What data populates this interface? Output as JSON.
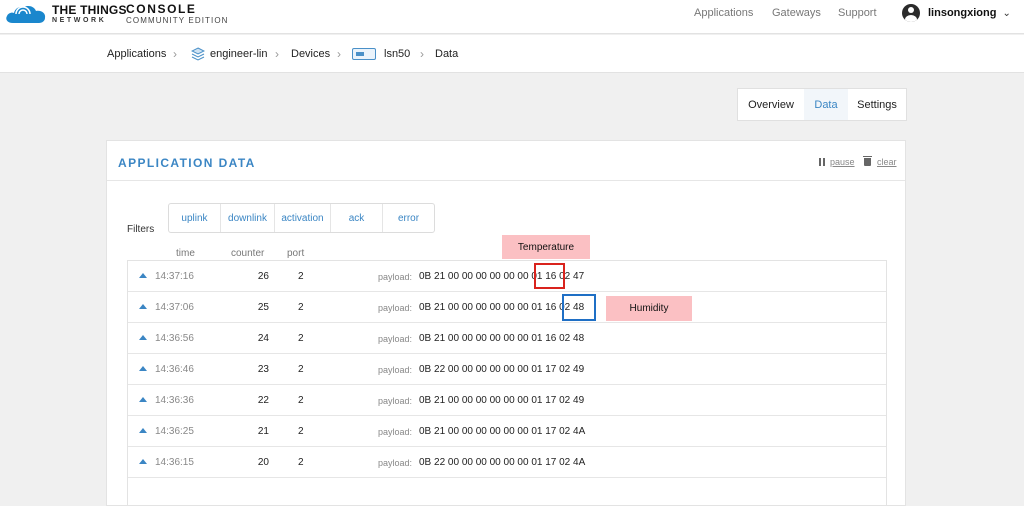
{
  "header": {
    "brand_line1": "THE THINGS",
    "brand_line2": "NETWORK",
    "console_title": "CONSOLE",
    "console_edition": "COMMUNITY EDITION",
    "nav": [
      "Applications",
      "Gateways",
      "Support"
    ],
    "username": "linsongxiong"
  },
  "breadcrumb": {
    "items": [
      "Applications",
      "engineer-lin",
      "Devices",
      "lsn50",
      "Data"
    ]
  },
  "tabs": [
    {
      "label": "Overview",
      "active": false
    },
    {
      "label": "Data",
      "active": true
    },
    {
      "label": "Settings",
      "active": false
    }
  ],
  "card": {
    "title": "APPLICATION DATA",
    "pause_label": "pause",
    "clear_label": "clear",
    "filters_label": "Filters",
    "filters": [
      "uplink",
      "downlink",
      "activation",
      "ack",
      "error"
    ],
    "columns": {
      "time": "time",
      "counter": "counter",
      "port": "port"
    },
    "payload_label": "payload:",
    "rows": [
      {
        "time": "14:37:16",
        "counter": "26",
        "port": "2",
        "payload": "0B 21 00 00 00 00 00 00 01 16 02 47"
      },
      {
        "time": "14:37:06",
        "counter": "25",
        "port": "2",
        "payload": "0B 21 00 00 00 00 00 00 01 16 02 48"
      },
      {
        "time": "14:36:56",
        "counter": "24",
        "port": "2",
        "payload": "0B 21 00 00 00 00 00 00 01 16 02 48"
      },
      {
        "time": "14:36:46",
        "counter": "23",
        "port": "2",
        "payload": "0B 22 00 00 00 00 00 00 01 17 02 49"
      },
      {
        "time": "14:36:36",
        "counter": "22",
        "port": "2",
        "payload": "0B 21 00 00 00 00 00 00 01 17 02 49"
      },
      {
        "time": "14:36:25",
        "counter": "21",
        "port": "2",
        "payload": "0B 21 00 00 00 00 00 00 01 17 02 4A"
      },
      {
        "time": "14:36:15",
        "counter": "20",
        "port": "2",
        "payload": "0B 22 00 00 00 00 00 00 01 17 02 4A"
      }
    ]
  },
  "annotations": {
    "temperature": "Temperature",
    "humidity": "Humidity",
    "temperature_box_color": "#d9231d",
    "humidity_box_color": "#1f6fc5"
  }
}
